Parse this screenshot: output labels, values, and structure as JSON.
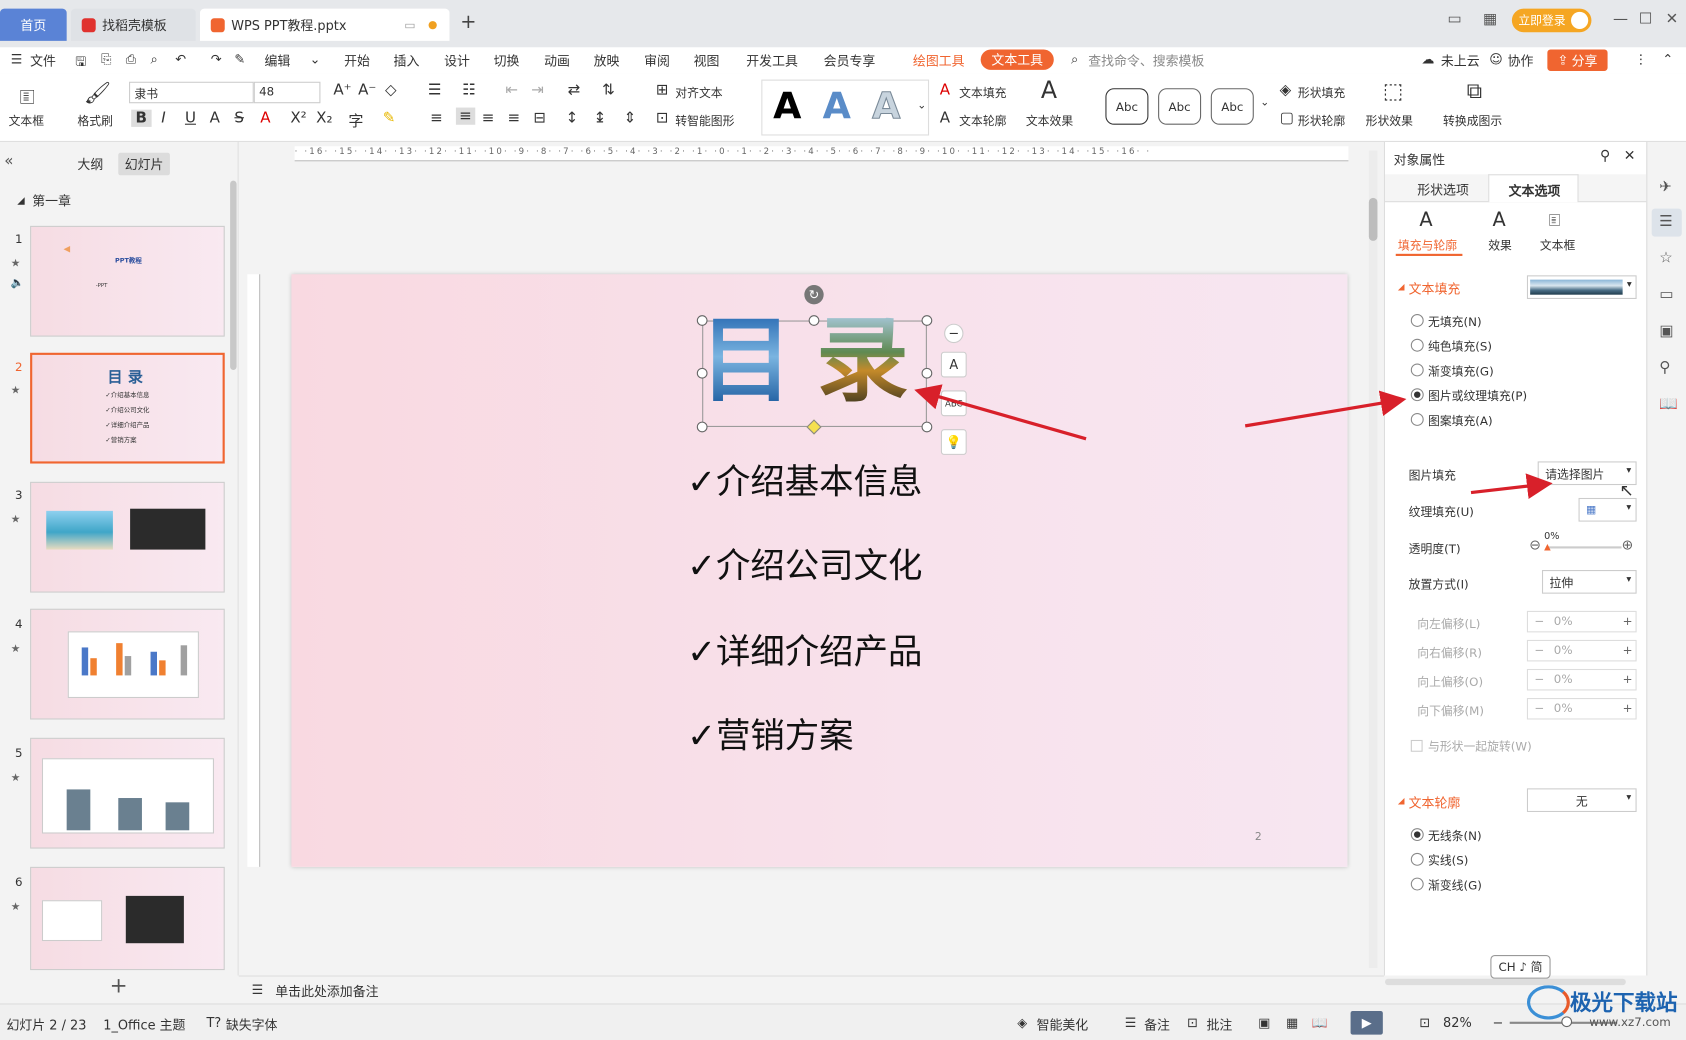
{
  "tabs": {
    "home": "首页",
    "template": "找稻壳模板",
    "document": "WPS PPT教程.pptx",
    "new_tab": "+"
  },
  "titlebar": {
    "login": "立即登录"
  },
  "menu": {
    "file": "文件",
    "edit": "编辑",
    "items": [
      "开始",
      "插入",
      "设计",
      "切换",
      "动画",
      "放映",
      "审阅",
      "视图",
      "开发工具",
      "会员专享"
    ],
    "drawing_tools": "绘图工具",
    "text_tools": "文本工具",
    "search": "查找命令、搜索模板",
    "cloud": "未上云",
    "collab": "协作",
    "share": "分享"
  },
  "ribbon": {
    "textbox": "文本框",
    "format_painter": "格式刷",
    "font_name": "隶书",
    "font_size": "48",
    "align_text": "对齐文本",
    "smart_shape": "转智能图形",
    "text_fill": "文本填充",
    "text_outline": "文本轮廓",
    "text_effect": "文本效果",
    "abc": [
      "Abc",
      "Abc",
      "Abc"
    ],
    "shape_fill": "形状填充",
    "shape_outline": "形状轮廓",
    "shape_effect": "形状效果",
    "convert_to_graphic": "转换成图示",
    "style_letter": "A"
  },
  "left_panel": {
    "outline_tab": "大纲",
    "slides_tab": "幻灯片",
    "chapter": "第一章",
    "slides": [
      {
        "num": "1",
        "title": "PPT教程",
        "sub": "-PPT"
      },
      {
        "num": "2",
        "title": "目 录",
        "lines": [
          "✓介绍基本信息",
          "✓介绍公司文化",
          "✓详细介绍产品",
          "✓营销方案"
        ]
      },
      {
        "num": "3"
      },
      {
        "num": "4"
      },
      {
        "num": "5"
      },
      {
        "num": "6"
      }
    ],
    "add": "+"
  },
  "slide": {
    "title_chars": [
      "目",
      "录"
    ],
    "bullets": [
      "✓介绍基本信息",
      "✓介绍公司文化",
      "✓详细介绍产品",
      "✓营销方案"
    ],
    "page_number": "2"
  },
  "right_panel": {
    "title": "对象属性",
    "tab_shape": "形状选项",
    "tab_text": "文本选项",
    "sub_fill": "填充与轮廓",
    "sub_effect": "效果",
    "sub_textbox": "文本框",
    "text_fill_header": "文本填充",
    "fill_options": [
      "无填充(N)",
      "纯色填充(S)",
      "渐变填充(G)",
      "图片或纹理填充(P)",
      "图案填充(A)"
    ],
    "selected_fill": "图片或纹理填充(P)",
    "picture_fill_label": "图片填充",
    "picture_fill_value": "请选择图片",
    "texture_fill_label": "纹理填充(U)",
    "transparency_label": "透明度(T)",
    "transparency_value": "0%",
    "placement_label": "放置方式(I)",
    "placement_value": "拉伸",
    "offsets": [
      {
        "label": "向左偏移(L)",
        "value": "0%"
      },
      {
        "label": "向右偏移(R)",
        "value": "0%"
      },
      {
        "label": "向上偏移(O)",
        "value": "0%"
      },
      {
        "label": "向下偏移(M)",
        "value": "0%"
      }
    ],
    "rotate_with_shape": "与形状一起旋转(W)",
    "text_outline_header": "文本轮廓",
    "text_outline_value": "无",
    "outline_options": [
      "无线条(N)",
      "实线(S)",
      "渐变线(G)"
    ],
    "ime": "CH ♪ 简"
  },
  "notes": {
    "placeholder": "单击此处添加备注"
  },
  "status": {
    "slide_counter": "幻灯片 2 / 23",
    "theme": "1_Office 主题",
    "missing_font": "缺失字体",
    "smart_beautify": "智能美化",
    "notes": "备注",
    "comments": "批注",
    "zoom": "82%"
  },
  "watermark": {
    "name": "极光下载站",
    "url": "www.xz7.com"
  },
  "colors": {
    "accent_orange": "#f06530",
    "tab_blue": "#5a83d6",
    "arrow_red": "#d8202a",
    "slide_pink": "#f9dde6"
  }
}
